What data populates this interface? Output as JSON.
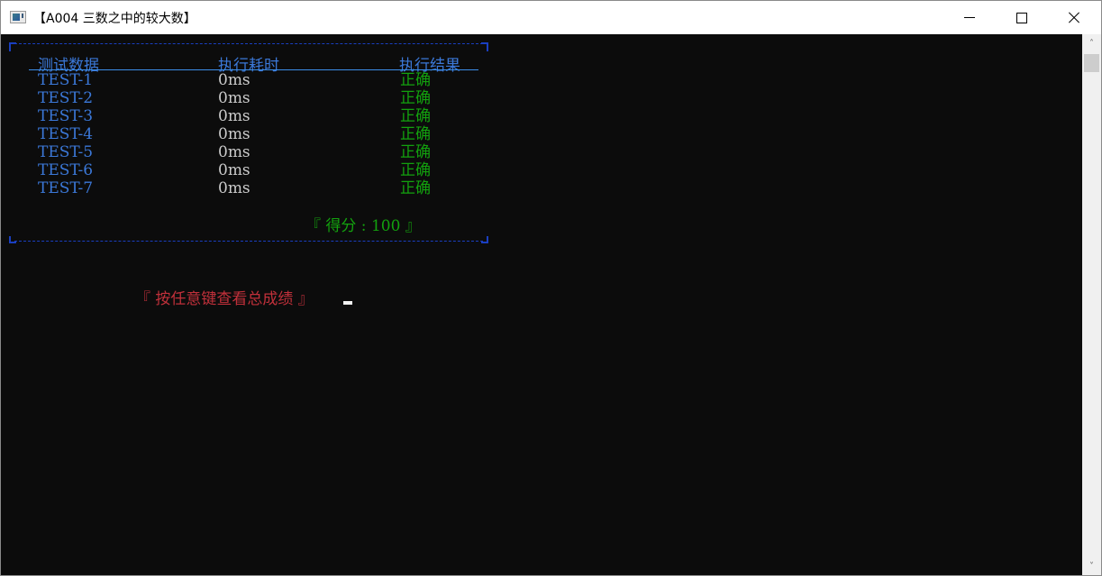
{
  "window": {
    "title": "【A004 三数之中的较大数】",
    "icon": "console-app-icon",
    "controls": {
      "minimize": "minimize-icon",
      "maximize": "maximize-icon",
      "close": "close-icon"
    }
  },
  "results_table": {
    "headers": {
      "name": "测试数据",
      "time": "执行耗时",
      "result": "执行结果"
    },
    "rows": [
      {
        "name": "TEST-1",
        "time": "0ms",
        "result": "正确"
      },
      {
        "name": "TEST-2",
        "time": "0ms",
        "result": "正确"
      },
      {
        "name": "TEST-3",
        "time": "0ms",
        "result": "正确"
      },
      {
        "name": "TEST-4",
        "time": "0ms",
        "result": "正确"
      },
      {
        "name": "TEST-5",
        "time": "0ms",
        "result": "正确"
      },
      {
        "name": "TEST-6",
        "time": "0ms",
        "result": "正确"
      },
      {
        "name": "TEST-7",
        "time": "0ms",
        "result": "正确"
      }
    ],
    "score_text": "『 得分 : 100 』",
    "score": 100
  },
  "prompt": {
    "text": "『 按任意键查看总成绩 』"
  },
  "colors": {
    "background": "#0c0c0c",
    "header_blue": "#3b78d8",
    "frame_blue": "#1a3fc0",
    "time_gray": "#cccccc",
    "pass_green": "#13a10e",
    "prompt_red": "#c0303a"
  },
  "scrollbar": {
    "up_arrow": "chevron-up-icon",
    "down_arrow": "chevron-down-icon"
  }
}
